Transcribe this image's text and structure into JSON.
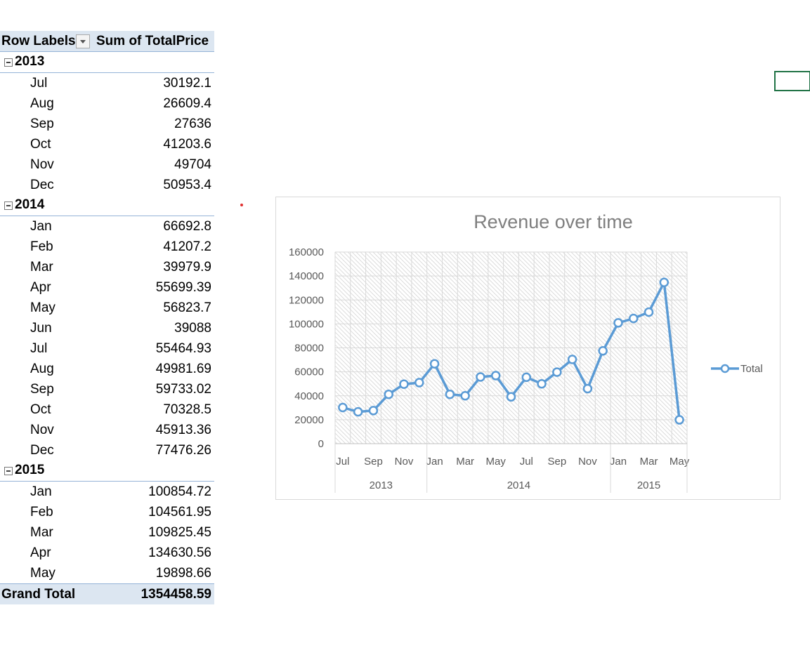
{
  "pivot": {
    "header_row_labels": "Row Labels",
    "header_sum": "Sum of TotalPrice",
    "years": [
      {
        "label": "2013",
        "months": [
          {
            "m": "Jul",
            "v": "30192.1"
          },
          {
            "m": "Aug",
            "v": "26609.4"
          },
          {
            "m": "Sep",
            "v": "27636"
          },
          {
            "m": "Oct",
            "v": "41203.6"
          },
          {
            "m": "Nov",
            "v": "49704"
          },
          {
            "m": "Dec",
            "v": "50953.4"
          }
        ]
      },
      {
        "label": "2014",
        "months": [
          {
            "m": "Jan",
            "v": "66692.8"
          },
          {
            "m": "Feb",
            "v": "41207.2"
          },
          {
            "m": "Mar",
            "v": "39979.9"
          },
          {
            "m": "Apr",
            "v": "55699.39"
          },
          {
            "m": "May",
            "v": "56823.7"
          },
          {
            "m": "Jun",
            "v": "39088"
          },
          {
            "m": "Jul",
            "v": "55464.93"
          },
          {
            "m": "Aug",
            "v": "49981.69"
          },
          {
            "m": "Sep",
            "v": "59733.02"
          },
          {
            "m": "Oct",
            "v": "70328.5"
          },
          {
            "m": "Nov",
            "v": "45913.36"
          },
          {
            "m": "Dec",
            "v": "77476.26"
          }
        ]
      },
      {
        "label": "2015",
        "months": [
          {
            "m": "Jan",
            "v": "100854.72"
          },
          {
            "m": "Feb",
            "v": "104561.95"
          },
          {
            "m": "Mar",
            "v": "109825.45"
          },
          {
            "m": "Apr",
            "v": "134630.56"
          },
          {
            "m": "May",
            "v": "19898.66"
          }
        ]
      }
    ],
    "grand_total_label": "Grand Total",
    "grand_total_value": "1354458.59"
  },
  "chart_data": {
    "type": "line",
    "title": "Revenue over time",
    "xlabel": "",
    "ylabel": "",
    "ylim": [
      0,
      160000
    ],
    "yticks": [
      0,
      20000,
      40000,
      60000,
      80000,
      100000,
      120000,
      140000,
      160000
    ],
    "categories": [
      "Jul",
      "Aug",
      "Sep",
      "Oct",
      "Nov",
      "Dec",
      "Jan",
      "Feb",
      "Mar",
      "Apr",
      "May",
      "Jun",
      "Jul",
      "Aug",
      "Sep",
      "Oct",
      "Nov",
      "Dec",
      "Jan",
      "Feb",
      "Mar",
      "Apr",
      "May"
    ],
    "category_years": [
      "2013",
      "2013",
      "2013",
      "2013",
      "2013",
      "2013",
      "2014",
      "2014",
      "2014",
      "2014",
      "2014",
      "2014",
      "2014",
      "2014",
      "2014",
      "2014",
      "2014",
      "2014",
      "2015",
      "2015",
      "2015",
      "2015",
      "2015"
    ],
    "year_groups": [
      "2013",
      "2014",
      "2015"
    ],
    "series": [
      {
        "name": "Total",
        "color": "#5b9bd5",
        "values": [
          30192.1,
          26609.4,
          27636,
          41203.6,
          49704,
          50953.4,
          66692.8,
          41207.2,
          39979.9,
          55699.39,
          56823.7,
          39088,
          55464.93,
          49981.69,
          59733.02,
          70328.5,
          45913.36,
          77476.26,
          100854.72,
          104561.95,
          109825.45,
          134630.56,
          19898.66
        ]
      }
    ],
    "legend": {
      "position": "right"
    },
    "grid": true
  }
}
